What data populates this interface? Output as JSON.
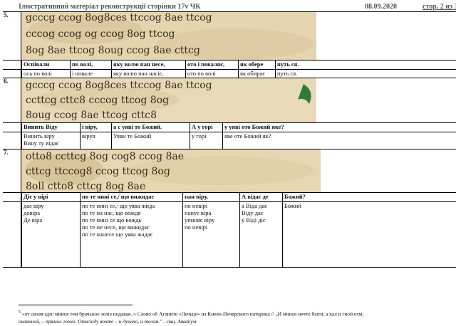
{
  "header": {
    "title": "Ілюстративний матеріал реконструкції сторінки 17v  ЧК",
    "date": "08.09.2020",
    "page": "стор. 2 из 3"
  },
  "sections": [
    {
      "number": "5.",
      "manuscript_lines": [
        "gcccg ccog 8og8ces ttccog 8ae ttcog",
        "cccog ccog og ccog 8og ttcog",
        "8og 8ae ttcog 8oug ccog 8ae cttcg"
      ],
      "headers": [
        "Оспівали",
        "по волі,",
        "яку волю пан несе,",
        "ото і поваляє,",
        "як обере",
        "путь ся."
      ],
      "values": [
        [
          "ось по волі"
        ],
        [
          "і повале"
        ],
        [
          "яку волю пан насіє,"
        ],
        [
          "ото по волі"
        ],
        [
          "як обирає"
        ],
        [
          "путь ся."
        ]
      ]
    },
    {
      "number": "6.",
      "manuscript_lines": [
        "gcccg ccog 8og8ces ttccog 8ae ttcog",
        "ccttcg cttc8 cccog ttcog 8og",
        "8oug ccog 8ae ttcog cttc8"
      ],
      "headers": [
        "Винить Віду",
        "і віру,",
        "а с уяві то Божий.",
        "А у горі",
        "у уяві ото Божий яке?"
      ],
      "values": [
        [
          "Винить віру",
          "Вину ту відає"
        ],
        [
          "віруя"
        ],
        [
          "Уяви те Божий"
        ],
        [
          "у горі"
        ],
        [
          "яве оте Божий як?"
        ]
      ]
    },
    {
      "number": "7.",
      "manuscript_lines": [
        "otto8 ccttcg 8og cog8 ccog 8ae",
        "cttcg ttccog8 ccog ttcog 8og",
        "8oll ctto8 cttcg 8og 8ae"
      ],
      "headers": [
        "Діє у вірі",
        "по те нині се,/ що вижидає",
        "пан віру.",
        "А відає де",
        "Божий?"
      ],
      "values": [
        [
          "дає віру",
          "довіра",
          "Де віра"
        ],
        [
          "по те нині се,/ що уява жида",
          "по те на нас, що вождя",
          "по те нині се що вождь",
          "по те не несе, ще вижидає",
          "по те нанесе що уява жадає"
        ],
        [
          "по невірі",
          "панує віра",
          "упиняє віру",
          "по невірі"
        ],
        [
          "а Віда дає",
          "Віду дає",
          "у Віді діє"
        ],
        [
          "Божий"
        ]
      ]
    }
  ],
  "footnote": {
    "marker": "5",
    "text_1": "«от своея єди: мнися тем брачьное зеліе подавая..» Слово об Агапите «Лечьце» из Киево-Печерского патерика // „И мнися нечто быти, а кал и гной есм,",
    "text_2": "окаянной, – прямое гоэно. Отвсюду воняю – и душею, и телом.\" - свщ. Аввакум."
  }
}
